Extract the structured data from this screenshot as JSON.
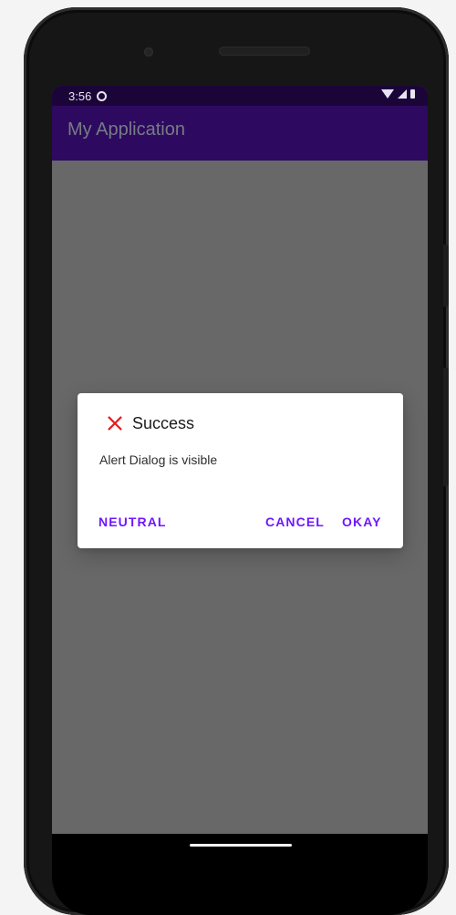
{
  "status_bar": {
    "time": "3:56"
  },
  "app_bar": {
    "title": "My Application"
  },
  "dialog": {
    "title": "Success",
    "message": "Alert Dialog is visible",
    "buttons": {
      "neutral": "NEUTRAL",
      "cancel": "CANCEL",
      "okay": "OKAY"
    },
    "icon": "error-icon",
    "colors": {
      "accent": "#6f16ff",
      "icon": "#e31b1b"
    }
  },
  "colors": {
    "status_bar": "#1b0538",
    "app_bar": "#2d0a5f",
    "scrim": "#686868",
    "dialog": "#ffffff"
  }
}
